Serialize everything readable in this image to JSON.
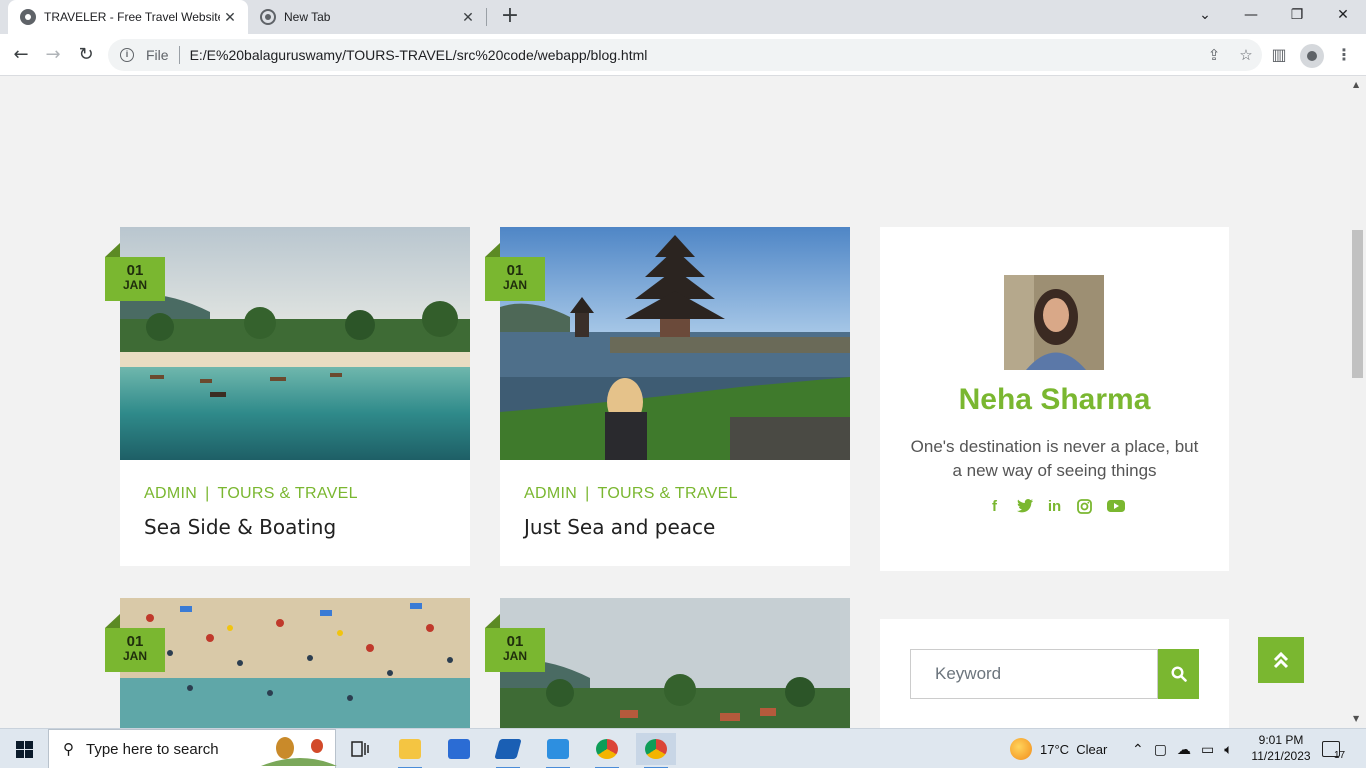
{
  "browser": {
    "tabs": [
      {
        "title": "TRAVELER - Free Travel Website",
        "active": true
      },
      {
        "title": "New Tab",
        "active": false
      }
    ],
    "address": {
      "scheme": "File",
      "url": "E:/E%20balaguruswamy/TOURS-TRAVEL/src%20code/webapp/blog.html"
    }
  },
  "blog": {
    "posts": [
      {
        "day": "01",
        "month": "JAN",
        "author": "ADMIN",
        "category": "TOURS & TRAVEL",
        "title": "Sea Side & Boating"
      },
      {
        "day": "01",
        "month": "JAN",
        "author": "ADMIN",
        "category": "TOURS & TRAVEL",
        "title": "Just Sea and peace"
      },
      {
        "day": "01",
        "month": "JAN"
      },
      {
        "day": "01",
        "month": "JAN"
      }
    ]
  },
  "author": {
    "name": "Neha Sharma",
    "bio": "One's destination is never a place, but a new way of seeing things",
    "socials": [
      "facebook-icon",
      "twitter-icon",
      "linkedin-icon",
      "instagram-icon",
      "youtube-icon"
    ]
  },
  "search": {
    "placeholder": "Keyword"
  },
  "taskbar": {
    "search_placeholder": "Type here to search",
    "weather": {
      "temp": "17°C",
      "condition": "Clear"
    },
    "time": "9:01 PM",
    "date": "11/21/2023",
    "notifications": "17"
  },
  "colors": {
    "accent": "#7ab730",
    "page_bg": "#f2f2f2"
  }
}
